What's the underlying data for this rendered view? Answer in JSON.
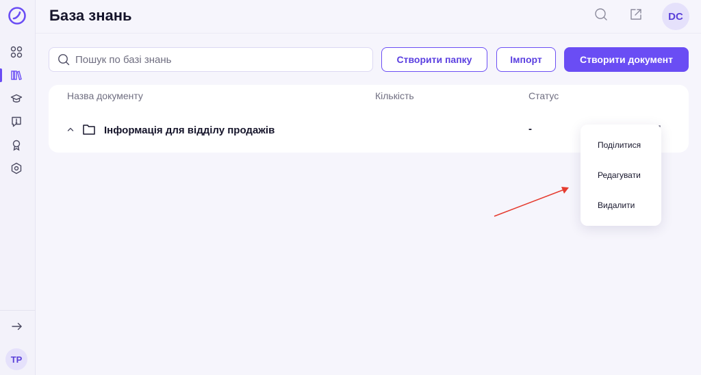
{
  "colors": {
    "accent": "#6a4df4",
    "annotation": "#e53b2f"
  },
  "sidebar": {
    "logo": "logo-icon",
    "items": [
      {
        "icon": "grid-icon"
      },
      {
        "icon": "books-icon",
        "active": true
      },
      {
        "icon": "graduation-cap-icon"
      },
      {
        "icon": "help-chat-icon"
      },
      {
        "icon": "award-icon"
      },
      {
        "icon": "settings-hexagon-icon"
      }
    ],
    "expand_icon": "arrow-right-icon",
    "user_initials": "TP"
  },
  "header": {
    "title": "База знань",
    "search_icon": "search-icon",
    "share_icon": "external-link-icon",
    "user_initials": "DC"
  },
  "toolbar": {
    "search_placeholder": "Пошук по базі знань",
    "create_folder_label": "Створити папку",
    "import_label": "Імпорт",
    "create_document_label": "Створити документ"
  },
  "table": {
    "columns": [
      "Назва документу",
      "Кількість",
      "Статус"
    ],
    "rows": [
      {
        "name": "Інформація для відділу продажів",
        "count": "",
        "status": "-"
      }
    ]
  },
  "context_menu": {
    "items": [
      "Поділитися",
      "Редагувати",
      "Видалити"
    ]
  }
}
